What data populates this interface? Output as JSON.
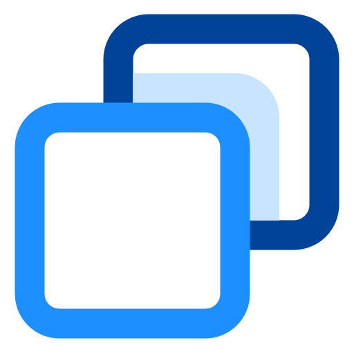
{
  "icon": {
    "name": "copy-icon",
    "colors": {
      "back_outline": "#00449A",
      "back_fill": "#C8E4FF",
      "front_outline": "#1E8FFF",
      "front_fill": "#FFFFFF",
      "background": "#FFFFFF"
    }
  }
}
